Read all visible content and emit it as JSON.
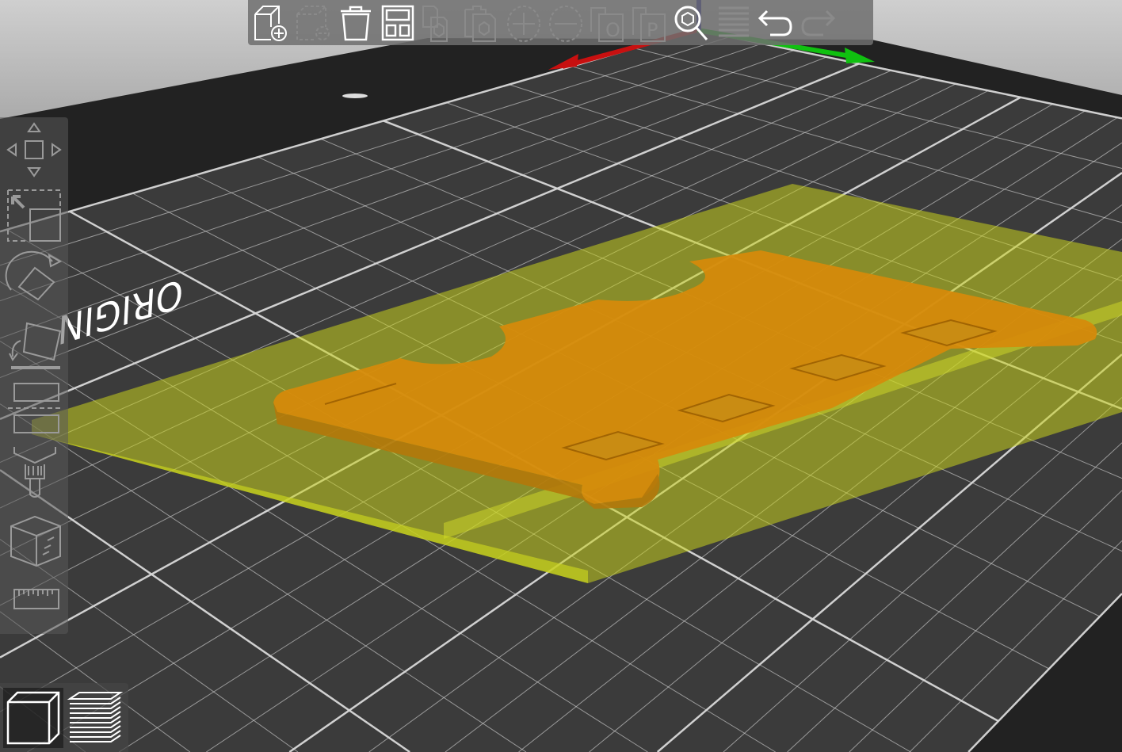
{
  "bed": {
    "label": "ORIGIN",
    "grid_divisions": 25,
    "major_every": 5
  },
  "colors": {
    "bed": "#3b3b3b",
    "bed_edge": "#1e1e1e",
    "grid": "#d8d8d8",
    "x_axis": "#c81010",
    "y_axis": "#10c010",
    "z_axis": "#1010a0",
    "plate": "#c8d21e",
    "part": "#d28a0a",
    "icon": "#ffffff",
    "icon_disabled": "#8a8a8a"
  },
  "top_toolbar": [
    {
      "icon": "add-object-icon",
      "enabled": true
    },
    {
      "icon": "delete-icon",
      "enabled": false
    },
    {
      "icon": "delete-all-icon",
      "enabled": true
    },
    {
      "icon": "arrange-icon",
      "enabled": true
    },
    {
      "icon": "copy-icon",
      "enabled": false
    },
    {
      "icon": "paste-icon",
      "enabled": false
    },
    {
      "icon": "add-instance-icon",
      "enabled": false
    },
    {
      "icon": "remove-instance-icon",
      "enabled": false
    },
    {
      "icon": "split-to-objects-icon",
      "enabled": false,
      "letter": "O"
    },
    {
      "icon": "split-to-parts-icon",
      "enabled": false,
      "letter": "P"
    },
    {
      "icon": "search-icon",
      "enabled": true
    },
    {
      "icon": "variable-layer-height-icon",
      "enabled": false
    },
    {
      "icon": "undo-icon",
      "enabled": true
    },
    {
      "icon": "redo-icon",
      "enabled": false
    }
  ],
  "left_toolbar": [
    {
      "icon": "move-icon"
    },
    {
      "icon": "scale-icon"
    },
    {
      "icon": "rotate-icon"
    },
    {
      "icon": "place-on-face-icon"
    },
    {
      "icon": "cut-icon"
    },
    {
      "icon": "paint-icon"
    },
    {
      "icon": "fdm-supports-icon"
    },
    {
      "icon": "measure-icon"
    }
  ],
  "view_toolbar": [
    {
      "icon": "3d-editor-view-icon",
      "selected": true
    },
    {
      "icon": "preview-layers-icon",
      "selected": false
    }
  ]
}
